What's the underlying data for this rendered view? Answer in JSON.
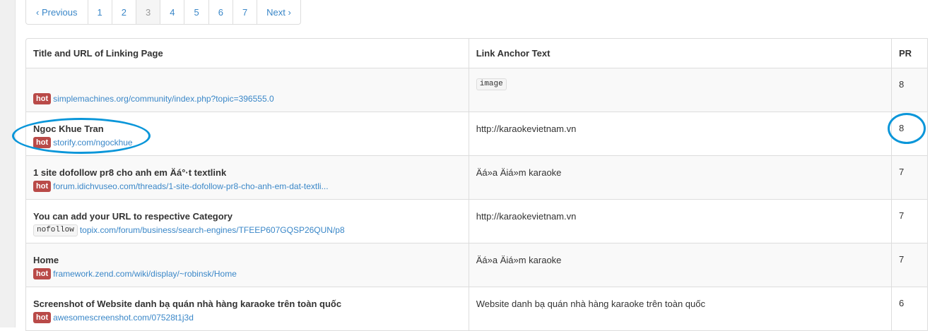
{
  "pagination": {
    "prev": "‹ Previous",
    "pages": [
      "1",
      "2",
      "3",
      "4",
      "5",
      "6",
      "7"
    ],
    "active": "3",
    "next": "Next ›"
  },
  "table": {
    "headers": {
      "title": "Title and URL of Linking Page",
      "anchor": "Link Anchor Text",
      "pr": "PR"
    },
    "rows": [
      {
        "title": "",
        "badge": "hot",
        "url": "simplemachines.org/community/index.php?topic=396555.0",
        "anchor_tag": "image",
        "anchor": "",
        "pr": "8"
      },
      {
        "title": "Ngoc Khue Tran",
        "badge": "hot",
        "url": "storify.com/ngockhue",
        "anchor_tag": "",
        "anchor": "http://karaokevietnam.vn",
        "pr": "8"
      },
      {
        "title": "1 site dofollow pr8 cho anh em Äá°·t textlink",
        "badge": "hot",
        "url": "forum.idichvuseo.com/threads/1-site-dofollow-pr8-cho-anh-em-dat-textli...",
        "anchor_tag": "",
        "anchor": "Äá»a Äiá»m karaoke",
        "pr": "7"
      },
      {
        "title": "You can add your URL to respective Category",
        "badge": "nofollow",
        "url": "topix.com/forum/business/search-engines/TFEEP607GQSP26QUN/p8",
        "anchor_tag": "",
        "anchor": "http://karaokevietnam.vn",
        "pr": "7"
      },
      {
        "title": "Home",
        "badge": "hot",
        "url": "framework.zend.com/wiki/display/~robinsk/Home",
        "anchor_tag": "",
        "anchor": "Äá»a Äiá»m karaoke",
        "pr": "7"
      },
      {
        "title": "Screenshot of Website danh bạ quán nhà hàng karaoke trên toàn quốc",
        "badge": "hot",
        "url": "awesomescreenshot.com/07528t1j3d",
        "anchor_tag": "",
        "anchor": "Website danh bạ quán nhà hàng karaoke trên toàn quốc",
        "pr": "6"
      }
    ]
  },
  "annotation_color": "#0a96d9"
}
